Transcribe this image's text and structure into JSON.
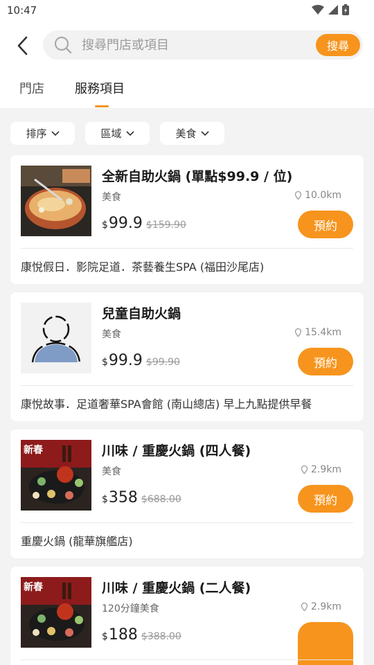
{
  "status_bar": {
    "time": "10:47",
    "icons": [
      "wifi-icon",
      "signal-icon",
      "battery-icon"
    ]
  },
  "header": {
    "back_icon": "chevron-left-icon",
    "search": {
      "placeholder": "搜尋門店或項目",
      "button_label": "搜尋",
      "icon": "search-icon"
    }
  },
  "tabs": [
    {
      "label": "門店",
      "active": false
    },
    {
      "label": "服務項目",
      "active": true
    }
  ],
  "filters": [
    {
      "label": "排序"
    },
    {
      "label": "區域"
    },
    {
      "label": "美食"
    }
  ],
  "items": [
    {
      "title": "全新自助火鍋 (單點$99.9 / 位)",
      "category": "美食",
      "distance": "10.0km",
      "currency": "$",
      "price": "99.9",
      "original_price": "$159.90",
      "book_label": "預約",
      "store": "康悅假日．影院足道．茶藝養生SPA (福田沙尾店)",
      "image": "hotpot-photo"
    },
    {
      "title": "兒童自助火鍋",
      "category": "美食",
      "distance": "15.4km",
      "currency": "$",
      "price": "99.9",
      "original_price": "$99.90",
      "book_label": "預約",
      "store": "康悅故事．足道奢華SPA會館 (南山總店) 早上九點提供早餐",
      "image": "placeholder-avatar"
    },
    {
      "title": "川味 / 重慶火鍋 (四人餐)",
      "category": "美食",
      "distance": "2.9km",
      "currency": "$",
      "price": "358",
      "original_price": "$688.00",
      "book_label": "預約",
      "store": "重慶火鍋 (龍華旗艦店)",
      "image": "new-year-banner",
      "banner_text": "新春"
    },
    {
      "title": "川味 / 重慶火鍋 (二人餐)",
      "category": "120分鐘美食",
      "distance": "2.9km",
      "currency": "$",
      "price": "188",
      "original_price": "$388.00",
      "book_label": "",
      "store": "",
      "image": "new-year-banner",
      "banner_text": "新春"
    }
  ],
  "colors": {
    "accent": "#f7941d",
    "background": "#f3f3f3"
  }
}
